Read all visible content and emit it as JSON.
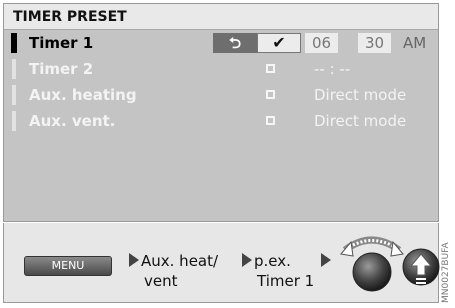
{
  "screen": {
    "title": "TIMER PRESET",
    "rows": [
      {
        "label": "Timer 1",
        "active": true
      },
      {
        "label": "Timer 2",
        "active": false,
        "value": "--  :  --"
      },
      {
        "label": "Aux. heating",
        "active": false,
        "value": "Direct mode"
      },
      {
        "label": "Aux. vent.",
        "active": false,
        "value": "Direct mode"
      }
    ],
    "timer1": {
      "back_symbol": "⮌",
      "check_symbol": "✔",
      "hour": "06",
      "minute": "30",
      "ampm": "AM"
    }
  },
  "bottom": {
    "menu_label": "MENU",
    "step1_line1": "Aux. heat/",
    "step1_line2": "vent",
    "step2_line1": "p.ex.",
    "step2_line2": "Timer 1",
    "knob_icon": "rotary-knob-icon",
    "push_icon": "push-button-icon"
  },
  "image_code": "MN0027BUFA"
}
